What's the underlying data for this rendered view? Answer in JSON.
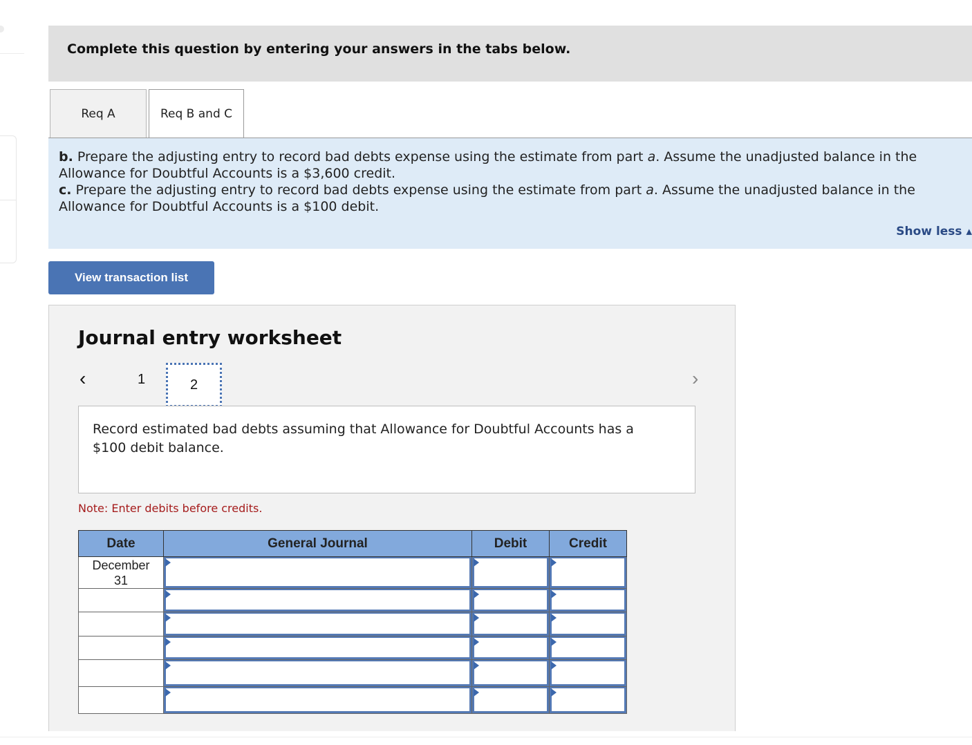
{
  "instruction": "Complete this question by entering your answers in the tabs below.",
  "tabs": [
    {
      "label": "Req A",
      "active": false
    },
    {
      "label": "Req B and C",
      "active": true
    }
  ],
  "prompt": {
    "b_label": "b.",
    "b_text": " Prepare the adjusting entry to record bad debts expense using the estimate from part ",
    "b_part": "a",
    "b_rest": ". Assume the unadjusted balance in the Allowance for Doubtful Accounts is a $3,600 credit.",
    "c_label": "c.",
    "c_text": " Prepare the adjusting entry to record bad debts expense using the estimate from part ",
    "c_part": "a",
    "c_rest": ". Assume the unadjusted balance in the Allowance for Doubtful Accounts is a $100 debit.",
    "show_less": "Show less ▴"
  },
  "view_transaction_list": "View transaction list",
  "worksheet": {
    "title": "Journal entry worksheet",
    "nav": {
      "prev": "‹",
      "pages": [
        "1",
        "2"
      ],
      "current": "2",
      "next": "›"
    },
    "description": "Record estimated bad debts assuming that Allowance for Doubtful Accounts has a $100 debit balance.",
    "note": "Note: Enter debits before credits.",
    "table": {
      "headers": [
        "Date",
        "General Journal",
        "Debit",
        "Credit"
      ],
      "rows": [
        {
          "date": "December 31",
          "account": "",
          "debit": "",
          "credit": ""
        },
        {
          "date": "",
          "account": "",
          "debit": "",
          "credit": ""
        },
        {
          "date": "",
          "account": "",
          "debit": "",
          "credit": ""
        },
        {
          "date": "",
          "account": "",
          "debit": "",
          "credit": ""
        },
        {
          "date": "",
          "account": "",
          "debit": "",
          "credit": ""
        },
        {
          "date": "",
          "account": "",
          "debit": "",
          "credit": ""
        }
      ]
    }
  }
}
